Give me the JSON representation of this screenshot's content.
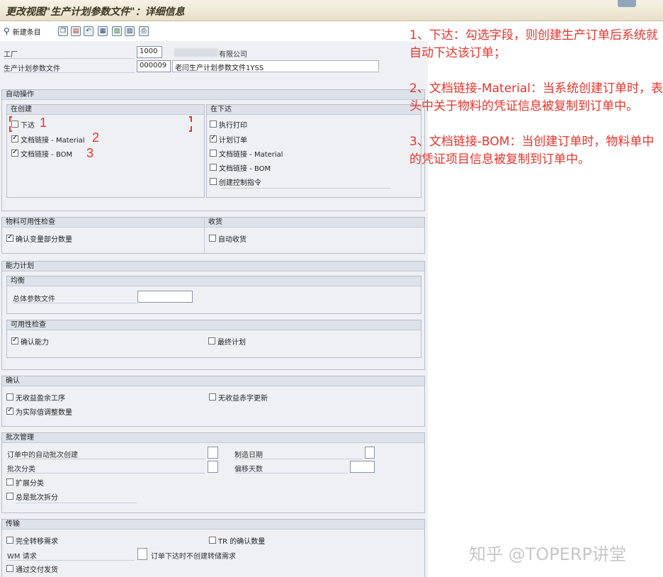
{
  "window": {
    "title": "更改视图\"生产计划参数文件\"：详细信息"
  },
  "toolbar": {
    "new_entry_label": "新建条目"
  },
  "header": {
    "plant_label": "工厂",
    "plant_value": "1000",
    "plant_desc": "有限公司",
    "profile_label": "生产计划参数文件",
    "profile_value": "000009",
    "profile_desc": "老闫生产计划参数文件1YSS"
  },
  "auto_ops": {
    "title": "自动操作",
    "on_create": {
      "title": "在创建",
      "items": [
        {
          "label": "下达",
          "checked": false
        },
        {
          "label": "文档链接 - Material",
          "checked": true
        },
        {
          "label": "文档链接 - BOM",
          "checked": true
        }
      ]
    },
    "on_release": {
      "title": "在下达",
      "items": [
        {
          "label": "执行打印",
          "checked": false
        },
        {
          "label": "计划订单",
          "checked": true
        },
        {
          "label": "文档链接 - Material",
          "checked": false
        },
        {
          "label": "文档链接 - BOM",
          "checked": false
        },
        {
          "label": "创建控制指令",
          "checked": false
        }
      ]
    }
  },
  "availability_check": {
    "title": "物料可用性检查",
    "item": {
      "label": "确认变量部分数量",
      "checked": true
    }
  },
  "goods_receipt": {
    "title": "收货",
    "item": {
      "label": "自动收货",
      "checked": false
    }
  },
  "capacity": {
    "title": "能力计划",
    "leveling": {
      "title": "均衡",
      "overall_profile_label": "总体参数文件",
      "overall_profile_value": ""
    },
    "avail": {
      "title": "可用性检查",
      "confirm": {
        "label": "确认能力",
        "checked": true
      },
      "final": {
        "label": "最终计划",
        "checked": false
      }
    }
  },
  "confirmation": {
    "title": "确认",
    "no_surplus": {
      "label": "无收益盈余工序",
      "checked": false
    },
    "no_deficit": {
      "label": "无收益赤字更新",
      "checked": false
    },
    "adjust_actual": {
      "label": "为实际值调整数量",
      "checked": true
    }
  },
  "batch": {
    "title": "批次管理",
    "auto_batch_label": "订单中的自动批次创建",
    "batch_class_label": "批次分类",
    "mfg_date_label": "制造日期",
    "offset_days_label": "偏移天数",
    "ext_class": {
      "label": "扩展分类",
      "checked": false
    },
    "always_split": {
      "label": "总是批次拆分",
      "checked": false
    }
  },
  "transport": {
    "title": "传输",
    "full_transfer": {
      "label": "完全转移需求",
      "checked": false
    },
    "tr_confirm": {
      "label": "TR 的确认数量",
      "checked": false
    },
    "wm_request_label": "WM 请求",
    "no_transfer_req_label": "订单下达时不创建转储需求",
    "via_delivery": {
      "label": "通过交付发货",
      "checked": false
    }
  },
  "annotations": {
    "markers": [
      "1",
      "2",
      "3"
    ],
    "notes": [
      "1、下达：勾选字段，则创建生产订单后系统就自动下达该订单；",
      "2、文档链接-Material：当系统创建订单时，表头中关于物料的凭证信息被复制到订单中。",
      "3、文档链接-BOM：当创建订单时，物料单中的凭证项目信息被复制到订单中。"
    ]
  },
  "watermark": "知乎 @TOPERP讲堂",
  "colors": {
    "annotation": "#e8332a",
    "panel": "#eef0f4",
    "group_header": "#dde2ea"
  }
}
